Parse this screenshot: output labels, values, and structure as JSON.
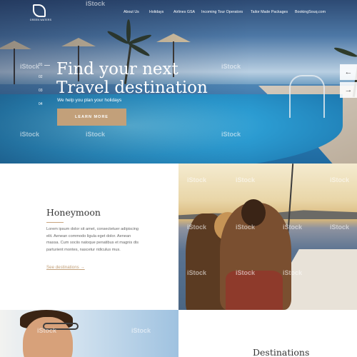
{
  "brand": {
    "logo_text": "GREEN WATERS"
  },
  "nav": {
    "items": [
      "About Us",
      "Holidays",
      "Airlines GSA",
      "Incoming Tour Operators",
      "Tailor Made Packages",
      "BookingSouq.com"
    ]
  },
  "hero": {
    "slide_indices": [
      "01",
      "02",
      "03",
      "04"
    ],
    "title_line1": "Find your next",
    "title_line2": "Travel destination",
    "subtitle": "We help you plan your holidays",
    "button_label": "LEARN MORE",
    "prev_arrow": "←",
    "next_arrow": "→"
  },
  "honeymoon": {
    "title": "Honeymoon",
    "description": "Lorem ipsum dolor sit amet, consectetuer adipiscing elit. Aenean commodo ligula eget dolor. Aenean massa. Cum sociis natoque penatibus et magnis dis parturient montes, nascetur ridiculus mus.",
    "link_label": "See destinations",
    "link_arrow": "→"
  },
  "destinations": {
    "title": "Destinations"
  },
  "watermark": "iStock",
  "colors": {
    "accent": "#c2a07a",
    "text_dark": "#333333",
    "text_muted": "#666666"
  }
}
